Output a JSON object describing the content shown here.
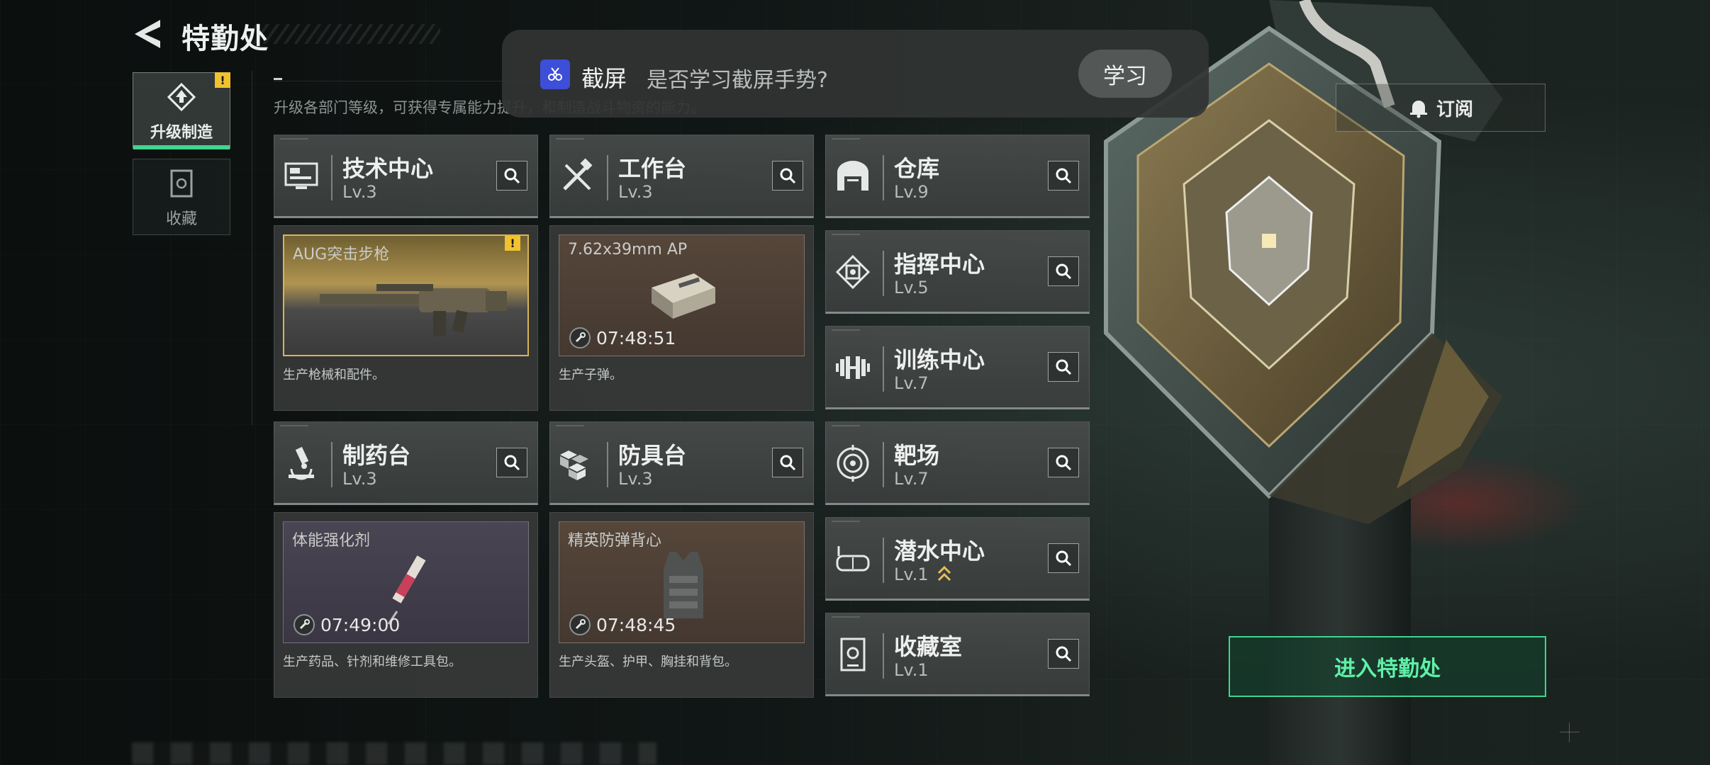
{
  "header": {
    "title": "特勤处",
    "subtitle": "升级各部门等级，可获得专属能力提升，和制造战斗物资的能力。"
  },
  "side_tabs": [
    {
      "label": "升级制造",
      "active": true,
      "badge": "!"
    },
    {
      "label": "收藏",
      "active": false
    }
  ],
  "departments": [
    {
      "name": "技术中心",
      "level": "Lv.3",
      "icon": "monitor-icon"
    },
    {
      "name": "工作台",
      "level": "Lv.3",
      "icon": "tools-icon"
    },
    {
      "name": "仓库",
      "level": "Lv.9",
      "icon": "warehouse-icon"
    },
    {
      "name": "指挥中心",
      "level": "Lv.5",
      "icon": "command-chip-icon"
    },
    {
      "name": "训练中心",
      "level": "Lv.7",
      "icon": "dumbbell-icon"
    },
    {
      "name": "制药台",
      "level": "Lv.3",
      "icon": "microscope-icon"
    },
    {
      "name": "防具台",
      "level": "Lv.3",
      "icon": "armor-blocks-icon"
    },
    {
      "name": "靶场",
      "level": "Lv.7",
      "icon": "target-icon"
    },
    {
      "name": "潜水中心",
      "level": "Lv.1",
      "icon": "diving-mask-icon",
      "upgrade_available": true
    },
    {
      "name": "收藏室",
      "level": "Lv.1",
      "icon": "collection-room-icon"
    }
  ],
  "production": [
    {
      "item": "AUG突击步枪",
      "timer": "",
      "description": "生产枪械和配件。",
      "highlight": true,
      "badge": "!"
    },
    {
      "item": "7.62x39mm AP",
      "timer": "07:48:51",
      "description": "生产子弹。"
    },
    {
      "item": "体能强化剂",
      "timer": "07:49:00",
      "description": "生产药品、针剂和维修工具包。"
    },
    {
      "item": "精英防弹背心",
      "timer": "07:48:45",
      "description": "生产头盔、护甲、胸挂和背包。"
    }
  ],
  "toast": {
    "app_name": "截屏",
    "message": "是否学习截屏手势?",
    "action": "学习"
  },
  "buttons": {
    "subscribe": "订阅",
    "enter": "进入特勤处"
  },
  "colors": {
    "accent_green": "#3fd58f",
    "badge_yellow": "#f0c231",
    "highlight_gold": "#d7b45a"
  }
}
